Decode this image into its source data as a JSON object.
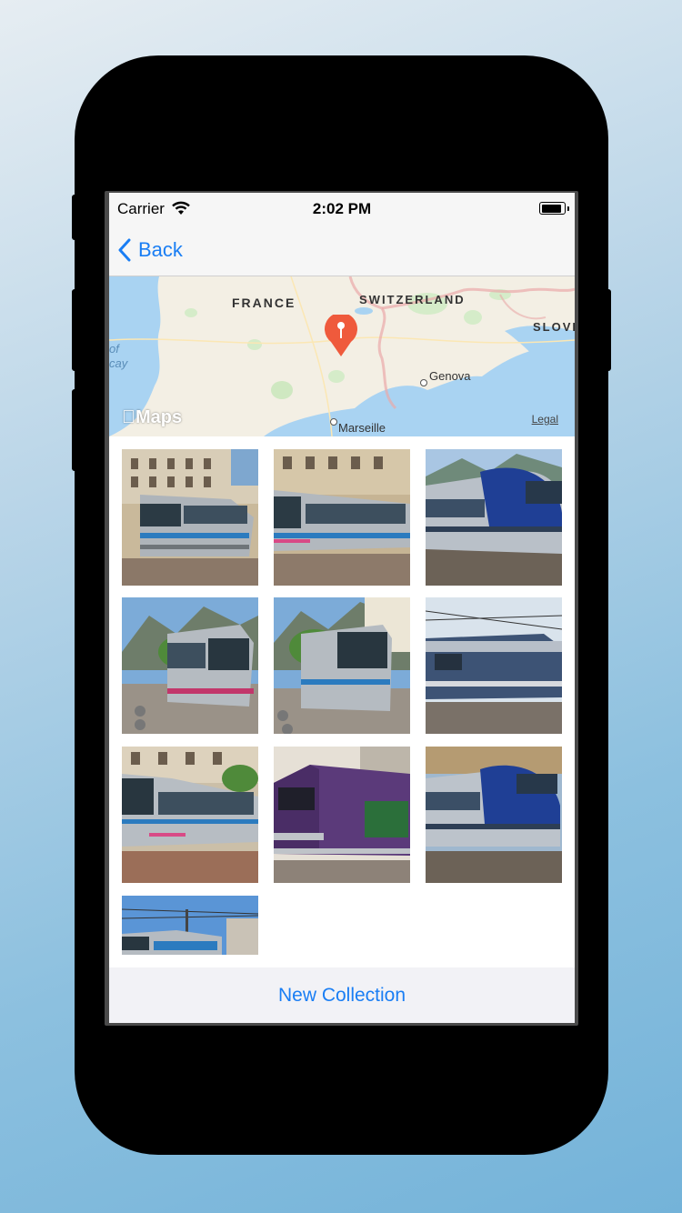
{
  "status_bar": {
    "carrier": "Carrier",
    "time": "2:02 PM",
    "battery_level": 0.9
  },
  "nav": {
    "back_label": "Back"
  },
  "map": {
    "labels": {
      "france": "FRANCE",
      "switzerland": "SWITZERLAND",
      "slove": "SLOVE",
      "genova": "Genova",
      "marseille": "Marseille",
      "bay": "of\ncay"
    },
    "logo_text": "Maps",
    "legal": "Legal"
  },
  "photos": [
    {
      "id": 1,
      "subject": "tram-city"
    },
    {
      "id": 2,
      "subject": "tram-street"
    },
    {
      "id": 3,
      "subject": "regional-train-blue"
    },
    {
      "id": 4,
      "subject": "tram-mountain"
    },
    {
      "id": 5,
      "subject": "tram-front"
    },
    {
      "id": 6,
      "subject": "diesel-locomotive"
    },
    {
      "id": 7,
      "subject": "tram-side"
    },
    {
      "id": 8,
      "subject": "purple-train"
    },
    {
      "id": 9,
      "subject": "regional-train-blue-2"
    },
    {
      "id": 10,
      "subject": "train-station-partial"
    }
  ],
  "bottom": {
    "new_collection_label": "New Collection"
  },
  "colors": {
    "accent": "#1a7ef4",
    "pin": "#ef5a3c"
  }
}
